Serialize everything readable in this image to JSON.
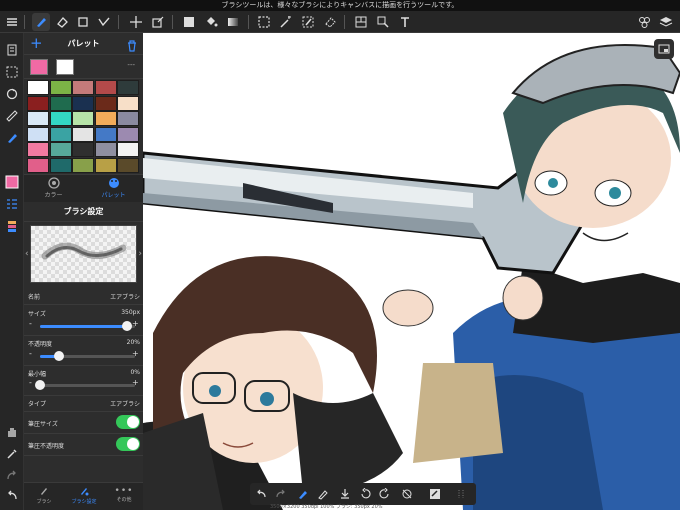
{
  "hint": "ブラシツールは、様々なブラシによりキャンバスに描画を行うツールです。",
  "palette": {
    "title": "パレット",
    "current_colors": [
      "#f06aa4",
      "#ffffff"
    ],
    "more": "---",
    "swatches": [
      [
        "#ffffff",
        "#7cb346",
        "#c47a7a",
        "#b34a4a",
        "#2e3b3b"
      ],
      [
        "#8a1f1f",
        "#1f6b4e",
        "#1a3050",
        "#6b2a1a",
        "#f7dfc8"
      ],
      [
        "#d9e9f7",
        "#33d6c4",
        "#b7e4a8",
        "#f2ac5a",
        "#8a8aa0"
      ],
      [
        "#cfe0f5",
        "#3aa3a3",
        "#e4e4e4",
        "#4479c6",
        "#9c8ab0"
      ],
      [
        "#f27aa1",
        "#57a89a",
        "#2f2f2f",
        "#8f8fa0",
        "#f2f2f2"
      ],
      [
        "#e15f8a",
        "#1f6a6a",
        "#88a04a",
        "#b8a046",
        "#5a4a2a"
      ]
    ]
  },
  "mode_tabs": {
    "color": "カラー",
    "palette": "パレット"
  },
  "brush": {
    "header": "ブラシ設定",
    "name_label": "名前",
    "name_value": "エアブラシ",
    "size_label": "サイズ",
    "size_value": "350px",
    "size_fraction": 0.92,
    "opacity_label": "不透明度",
    "opacity_value": "20%",
    "opacity_fraction": 0.2,
    "min_label": "最小幅",
    "min_value": "0%",
    "min_fraction": 0.0,
    "type_label": "タイプ",
    "type_value": "エアブラシ",
    "pressure_size_label": "筆圧サイズ",
    "pressure_opacity_label": "筆圧不透明度"
  },
  "bottom_tabs": {
    "brush": "ブラシ",
    "brush_settings": "ブラシ設定",
    "other": "その他"
  },
  "status": "3500×3200 350dpi 100% ブラシ: 350px 20%"
}
